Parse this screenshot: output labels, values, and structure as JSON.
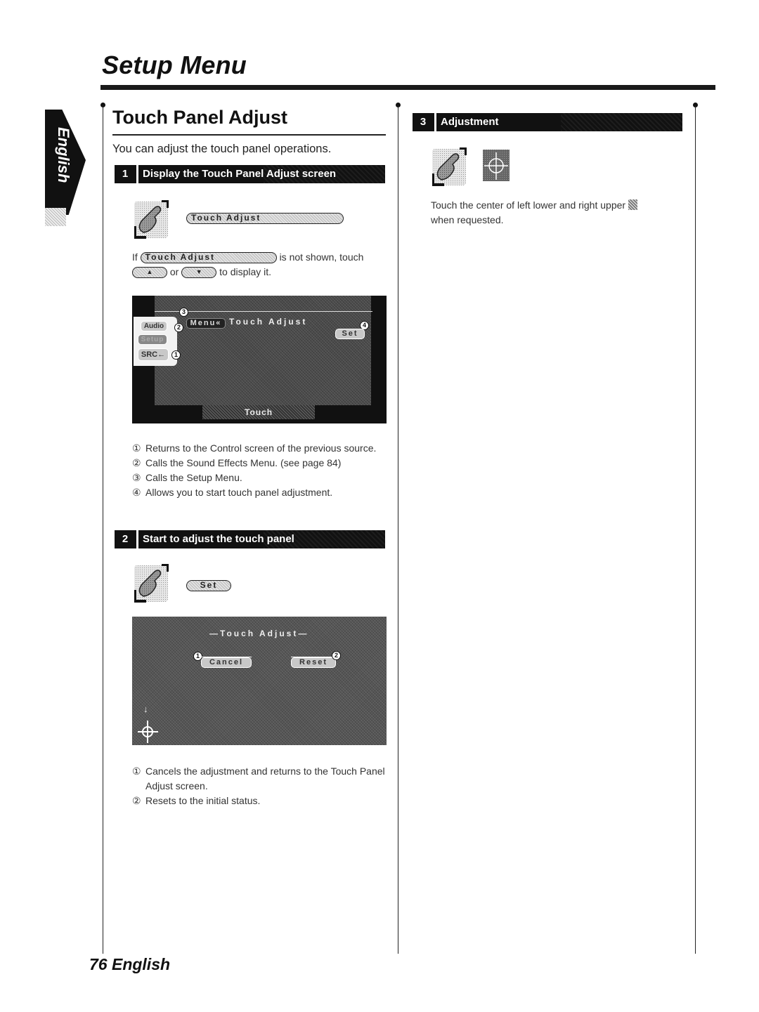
{
  "header": {
    "title": "Setup Menu"
  },
  "language_tab": {
    "label": "English"
  },
  "section": {
    "title": "Touch Panel Adjust",
    "intro": "You can adjust the touch panel operations."
  },
  "steps": [
    {
      "number": "1",
      "label": "Display the Touch Panel Adjust screen",
      "button_label": "Touch Adjust",
      "note": {
        "prefix": "If",
        "button_label": "Touch Adjust",
        "middle": "is not shown, touch",
        "up_button": "▲",
        "or": "or",
        "down_button": "▼",
        "suffix": "to display it."
      },
      "screen": {
        "title_left": "Menu«",
        "title": "Touch Adjust",
        "set_button": "Set",
        "side_buttons": [
          "Audio",
          "Setup",
          "SRC←"
        ],
        "footer_label": "Touch",
        "callouts": [
          "1",
          "2",
          "3",
          "4"
        ]
      },
      "legend": [
        {
          "marker": "①",
          "text": "Returns to the Control screen of the previous source."
        },
        {
          "marker": "②",
          "text": "Calls the Sound Effects Menu. (see page 84)"
        },
        {
          "marker": "③",
          "text": "Calls the Setup Menu."
        },
        {
          "marker": "④",
          "text": "Allows you to start touch panel adjustment."
        }
      ]
    },
    {
      "number": "2",
      "label": "Start to adjust the touch panel",
      "button_label": "Set",
      "screen": {
        "title": "—Touch Adjust—",
        "cancel_button": "Cancel",
        "reset_button": "Reset",
        "callouts": [
          "1",
          "2"
        ],
        "arrow": "↓"
      },
      "legend": [
        {
          "marker": "①",
          "text": "Cancels the adjustment and returns to the Touch Panel Adjust screen."
        },
        {
          "marker": "②",
          "text": "Resets to the initial status."
        }
      ]
    },
    {
      "number": "3",
      "label": "Adjustment",
      "description": "Touch the center of left lower and right upper",
      "description_end": "when requested."
    }
  ],
  "footer": {
    "page_label": "76 English"
  }
}
